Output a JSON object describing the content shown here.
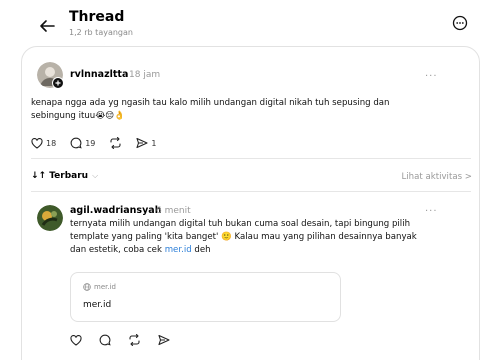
{
  "header": {
    "title": "Thread",
    "subtitle": "1,2 rb tayangan"
  },
  "main_post": {
    "username": "rvlnnazltta",
    "time": "18 jam",
    "text": "kenapa ngga ada yg ngasih tau kalo milih undangan digital nikah tuh sepusing dan\nsebingung ituu😭😔👌",
    "likes": "18",
    "comments": "19",
    "shares": "1"
  },
  "sort": {
    "label": "↓↑ Terbaru",
    "activity_label": "Lihat aktivitas >"
  },
  "reply": {
    "username": "agil.wadriansyah",
    "time": "6 menit",
    "text_before_link": "ternyata milih undangan digital tuh bukan cuma soal desain, tapi bingung pilih\ntemplate yang paling 'kita banget' 🙂 Kalau mau yang pilihan desainnya banyak\ndan estetik, coba cek ",
    "link_text": "mer.id",
    "text_after_link": " deh",
    "link_card": {
      "domain": "mer.id",
      "title": "mer.id"
    }
  },
  "colors": {
    "link": "#2d7fd8",
    "muted": "#999999",
    "border": "#e2e2e2"
  }
}
